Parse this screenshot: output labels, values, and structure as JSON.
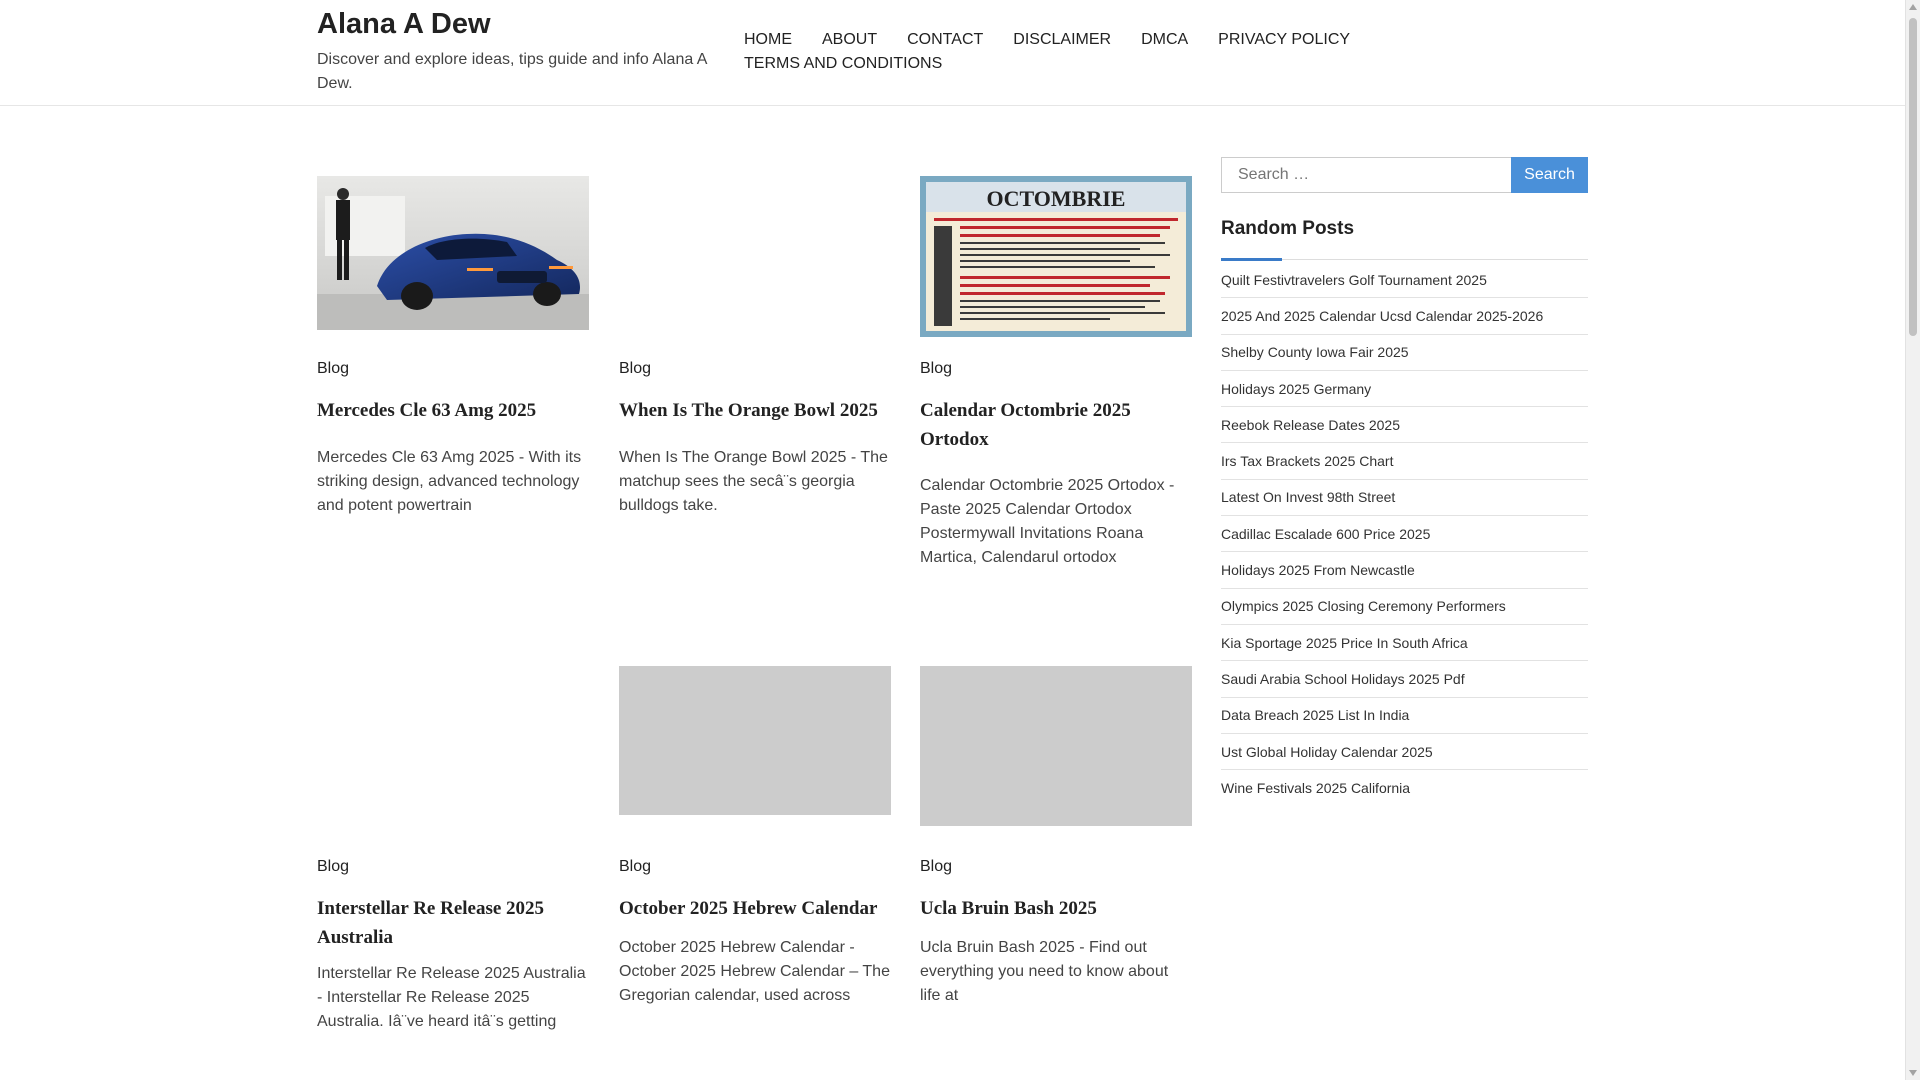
{
  "site": {
    "title": "Alana A Dew",
    "description": "Discover and explore ideas, tips guide and info Alana A Dew."
  },
  "nav": [
    "HOME",
    "ABOUT",
    "CONTACT",
    "DISCLAIMER",
    "DMCA",
    "PRIVACY POLICY",
    "TERMS AND CONDITIONS"
  ],
  "posts": [
    {
      "category": "Blog",
      "title": "Mercedes Cle 63 Amg 2025",
      "excerpt": "Mercedes Cle 63 Amg 2025 - With its striking design, advanced technology and potent powertrain",
      "image": "blue Mercedes coupe on display with presenter"
    },
    {
      "category": "Blog",
      "title": "When Is The Orange Bowl 2025",
      "excerpt": "When Is The Orange Bowl 2025 - The matchup sees the secâ¨s georgia bulldogs take.",
      "image": "none"
    },
    {
      "category": "Blog",
      "title": "Calendar Octombrie 2025 Ortodox",
      "excerpt": "Calendar Octombrie 2025 Ortodox - Paste 2025 Calendar Ortodox Postermywall Invitations Roana Martica, Calendarul ortodox",
      "image": "orthodox calendar page titled OCTOMBRIE",
      "image_heading": "OCTOMBRIE"
    },
    {
      "category": "Blog",
      "title": "Interstellar Re Release 2025 Australia",
      "excerpt": "Interstellar Re Release 2025 Australia - Interstellar Re Release 2025 Australia. Iâ¨ve heard itâ¨s getting",
      "image": "none"
    },
    {
      "category": "Blog",
      "title": "October 2025 Hebrew Calendar",
      "excerpt": "October 2025 Hebrew Calendar - October 2025 Hebrew Calendar – The Gregorian calendar, used across",
      "image": "gray placeholder"
    },
    {
      "category": "Blog",
      "title": "Ucla Bruin Bash 2025",
      "excerpt": "Ucla Bruin Bash 2025 - Find out everything you need to know about life at",
      "image": "gray placeholder"
    }
  ],
  "sidebar": {
    "search_placeholder": "Search …",
    "search_button": "Search",
    "random_title": "Random Posts",
    "random_posts": [
      "Quilt Festivtravelers Golf Tournament 2025",
      "2025 And 2025 Calendar Ucsd Calendar 2025-2026",
      "Shelby County Iowa Fair 2025",
      "Holidays 2025 Germany",
      "Reebok Release Dates 2025",
      "Irs Tax Brackets 2025 Chart",
      "Latest On Invest 98th Street",
      "Cadillac Escalade 600 Price 2025",
      "Holidays 2025 From Newcastle",
      "Olympics 2025 Closing Ceremony Performers",
      "Kia Sportage 2025 Price In South Africa",
      "Saudi Arabia School Holidays 2025 Pdf",
      "Data Breach 2025 List In India",
      "Ust Global Holiday Calendar 2025",
      "Wine Festivals 2025 California"
    ]
  },
  "colors": {
    "accent": "#3a7bc8",
    "search_button": "#4a90d9",
    "placeholder": "#cccccc"
  }
}
